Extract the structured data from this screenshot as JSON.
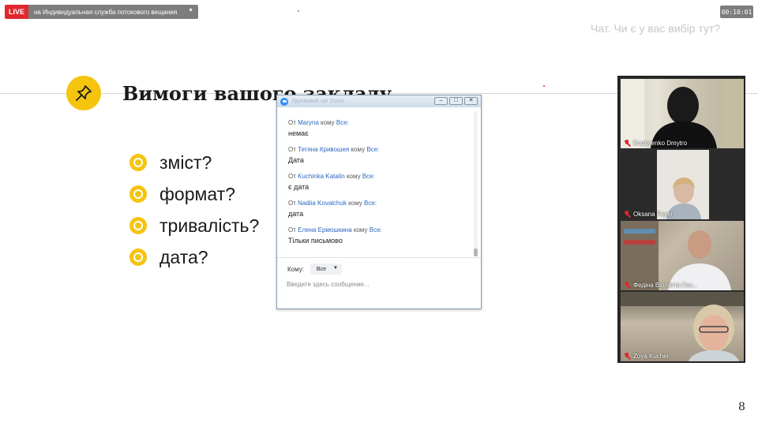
{
  "topbar": {
    "live_label": "LIVE",
    "stream_label": "на Индивидуальная служба потокового вещания",
    "timer": "00:10:01"
  },
  "slide": {
    "subtitle": "Чат. Чи є у вас вибір тут?",
    "title": "Вимоги вашого закладу",
    "bullets": [
      "зміст?",
      "формат?",
      "тривалість?",
      "дата?"
    ],
    "page_number": "8"
  },
  "chat": {
    "window_title": "Групповой чат Zoom",
    "from_prefix": "От",
    "to_word": "кому",
    "recipient": "Все:",
    "messages": [
      {
        "sender": "Maryna",
        "text": "немає"
      },
      {
        "sender": "Тетяна Кривошея",
        "text": "Дата"
      },
      {
        "sender": "Kuchinka Katalin",
        "text": "є дата"
      },
      {
        "sender": "Nadiia Kovalchuk",
        "text": "дата"
      },
      {
        "sender": "Елена Ермошкина",
        "text": "Тільки письмово"
      }
    ],
    "to_label": "Кому:",
    "to_value": "Все",
    "input_placeholder": "Введите здесь сообщение..."
  },
  "participants": [
    {
      "name": "Kupriyenko Dmytro"
    },
    {
      "name": "Oksana Feyer"
    },
    {
      "name": "Федіна Віолетта Ген..."
    },
    {
      "name": "Zoya Kucher"
    }
  ],
  "colors": {
    "live": "#e0282d",
    "accent_yellow": "#f5c40f",
    "link_blue": "#2d68c4"
  }
}
